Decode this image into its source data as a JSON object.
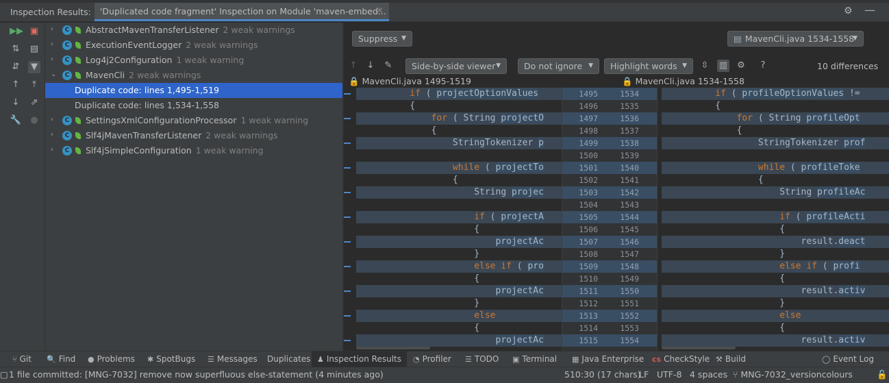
{
  "header": {
    "title": "Inspection Results:",
    "tab_label": "'Duplicated code fragment' Inspection on Module 'maven-embed...",
    "tab_close": "×"
  },
  "tree": [
    {
      "name": "AbstractMavenTransferListener",
      "warn": "2 weak warnings",
      "icon": "C"
    },
    {
      "name": "ExecutionEventLogger",
      "warn": "2 weak warnings",
      "icon": "C"
    },
    {
      "name": "Log4j2Configuration",
      "warn": "1 weak warning",
      "icon": "C"
    },
    {
      "name": "MavenCli",
      "warn": "2 weak warnings",
      "icon": "C"
    },
    {
      "label": "Duplicate code: lines 1,495-1,519"
    },
    {
      "label": "Duplicate code: lines 1,534-1,558"
    },
    {
      "name": "SettingsXmlConfigurationProcessor",
      "warn": "1 weak warning",
      "icon": "C"
    },
    {
      "name": "Slf4jMavenTransferListener",
      "warn": "2 weak warnings",
      "icon": "C"
    },
    {
      "name": "Slf4jSimpleConfiguration",
      "warn": "1 weak warning",
      "icon": "C"
    }
  ],
  "diff": {
    "suppress": "Suppress",
    "file_select": "MavenCli.java 1534-1558",
    "viewer": "Side-by-side viewer",
    "ignore": "Do not ignore",
    "highlight": "Highlight words",
    "help": "?",
    "differences": "10 differences",
    "left_file": "MavenCli.java 1495-1519",
    "right_file": "MavenCli.java 1534-1558"
  },
  "code_left": [
    {
      "indent": "          ",
      "kw": "if",
      "rest": " ( ",
      "idv": "projectOptionValues",
      "tail": ""
    },
    {
      "indent": "          ",
      "plain": "{"
    },
    {
      "indent": "              ",
      "kw": "for",
      "rest": " ( String ",
      "idv": "projectO",
      "tail": ""
    },
    {
      "indent": "              ",
      "plain": "{"
    },
    {
      "indent": "                  ",
      "rest": "StringTokenizer ",
      "idv": "p",
      "tail": ""
    },
    {
      "indent": "",
      "plain": ""
    },
    {
      "indent": "                  ",
      "kw": "while",
      "rest": " ( ",
      "idv": "projectTo",
      "tail": ""
    },
    {
      "indent": "                  ",
      "plain": "{"
    },
    {
      "indent": "                      ",
      "rest": "String ",
      "idv": "projec",
      "tail": ""
    },
    {
      "indent": "",
      "plain": ""
    },
    {
      "indent": "                      ",
      "kw": "if",
      "rest": " ( ",
      "idv": "projectA",
      "tail": ""
    },
    {
      "indent": "                      ",
      "plain": "{"
    },
    {
      "indent": "                          ",
      "idv": "projectAc",
      "tail": ""
    },
    {
      "indent": "                      ",
      "plain": "}"
    },
    {
      "indent": "                      ",
      "kw": "else if",
      "rest": " ( ",
      "idv": "pro",
      "tail": ""
    },
    {
      "indent": "                      ",
      "plain": "{"
    },
    {
      "indent": "                          ",
      "idv": "projectAc",
      "tail": ""
    },
    {
      "indent": "                      ",
      "plain": "}"
    },
    {
      "indent": "                      ",
      "kw": "else",
      "rest": "",
      "tail": ""
    },
    {
      "indent": "                      ",
      "plain": "{"
    },
    {
      "indent": "                          ",
      "idv": "projectAc",
      "tail": ""
    }
  ],
  "code_right": [
    {
      "indent": "          ",
      "kw": "if",
      "rest": " ( ",
      "idv": "profileOptionValues",
      "tail": " !="
    },
    {
      "indent": "          ",
      "plain": "{"
    },
    {
      "indent": "              ",
      "kw": "for",
      "rest": " ( String ",
      "idv": "profileOpt",
      "tail": ""
    },
    {
      "indent": "              ",
      "plain": "{"
    },
    {
      "indent": "                  ",
      "rest": "StringTokenizer ",
      "idv": "prof",
      "tail": ""
    },
    {
      "indent": "",
      "plain": ""
    },
    {
      "indent": "                  ",
      "kw": "while",
      "rest": " ( ",
      "idv": "profileToke",
      "tail": ""
    },
    {
      "indent": "                  ",
      "plain": "{"
    },
    {
      "indent": "                      ",
      "rest": "String ",
      "idv": "profileAc",
      "tail": ""
    },
    {
      "indent": "",
      "plain": ""
    },
    {
      "indent": "                      ",
      "kw": "if",
      "rest": " ( ",
      "idv": "profileActi",
      "tail": ""
    },
    {
      "indent": "                      ",
      "plain": "{"
    },
    {
      "indent": "                          ",
      "rest": "result.",
      "idv": "deact",
      "tail": ""
    },
    {
      "indent": "                      ",
      "plain": "}"
    },
    {
      "indent": "                      ",
      "kw": "else if",
      "rest": " ( ",
      "idv": "profi",
      "tail": ""
    },
    {
      "indent": "                      ",
      "plain": "{"
    },
    {
      "indent": "                          ",
      "rest": "result.",
      "idv": "activ",
      "tail": ""
    },
    {
      "indent": "                      ",
      "plain": "}"
    },
    {
      "indent": "                      ",
      "kw": "else",
      "rest": "",
      "tail": ""
    },
    {
      "indent": "                      ",
      "plain": "{"
    },
    {
      "indent": "                          ",
      "rest": "result.",
      "idv": "activ",
      "tail": ""
    }
  ],
  "gutter_left": [
    "1495",
    "1496",
    "1497",
    "1498",
    "1499",
    "1500",
    "1501",
    "1502",
    "1503",
    "1504",
    "1505",
    "1506",
    "1507",
    "1508",
    "1509",
    "1510",
    "1511",
    "1512",
    "1513",
    "1514",
    "1515"
  ],
  "gutter_right": [
    "1534",
    "1535",
    "1536",
    "1537",
    "1538",
    "1539",
    "1540",
    "1541",
    "1542",
    "1543",
    "1544",
    "1545",
    "1546",
    "1547",
    "1548",
    "1549",
    "1550",
    "1551",
    "1552",
    "1553",
    "1554"
  ],
  "highlighted_rows": [
    0,
    2,
    4,
    6,
    8,
    10,
    12,
    14,
    16,
    18,
    20
  ],
  "bottom_tabs": [
    {
      "icon": "⑂",
      "label": "Git"
    },
    {
      "icon": "🔍",
      "label": "Find"
    },
    {
      "icon": "●",
      "label": "Problems"
    },
    {
      "icon": "✱",
      "label": "SpotBugs"
    },
    {
      "icon": "☰",
      "label": "Messages"
    },
    {
      "icon": "",
      "label": "Duplicates"
    },
    {
      "icon": "♟",
      "label": "Inspection Results"
    },
    {
      "icon": "◔",
      "label": "Profiler"
    },
    {
      "icon": "☰",
      "label": "TODO"
    },
    {
      "icon": "▣",
      "label": "Terminal"
    },
    {
      "icon": "▦",
      "label": "Java Enterprise"
    },
    {
      "icon": "cs",
      "label": "CheckStyle"
    },
    {
      "icon": "⚒",
      "label": "Build"
    },
    {
      "icon": "◯",
      "label": "Event Log"
    }
  ],
  "status": {
    "message": "1 file committed: [MNG-7032] remove now superfluous else-statement (4 minutes ago)",
    "position": "510:30 (17 chars)",
    "line_sep": "LF",
    "encoding": "UTF-8",
    "indent": "4 spaces",
    "branch": "MNG-7032_versioncolours"
  }
}
